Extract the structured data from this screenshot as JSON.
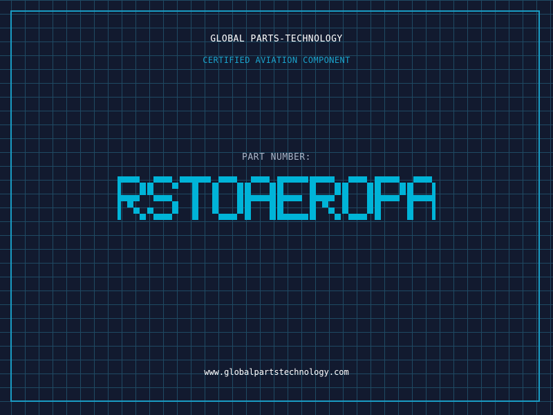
{
  "header": {
    "company": "GLOBAL PARTS-TECHNOLOGY",
    "subtitle": "CERTIFIED AVIATION COMPONENT"
  },
  "part": {
    "label": "PART NUMBER:",
    "number": "RSTOAEROPA"
  },
  "footer": {
    "website": "www.globalpartstechnology.com"
  },
  "colors": {
    "background": "#121a2f",
    "grid": "#1f4a63",
    "accent": "#1a9cc4",
    "part_number": "#00b4d8"
  }
}
